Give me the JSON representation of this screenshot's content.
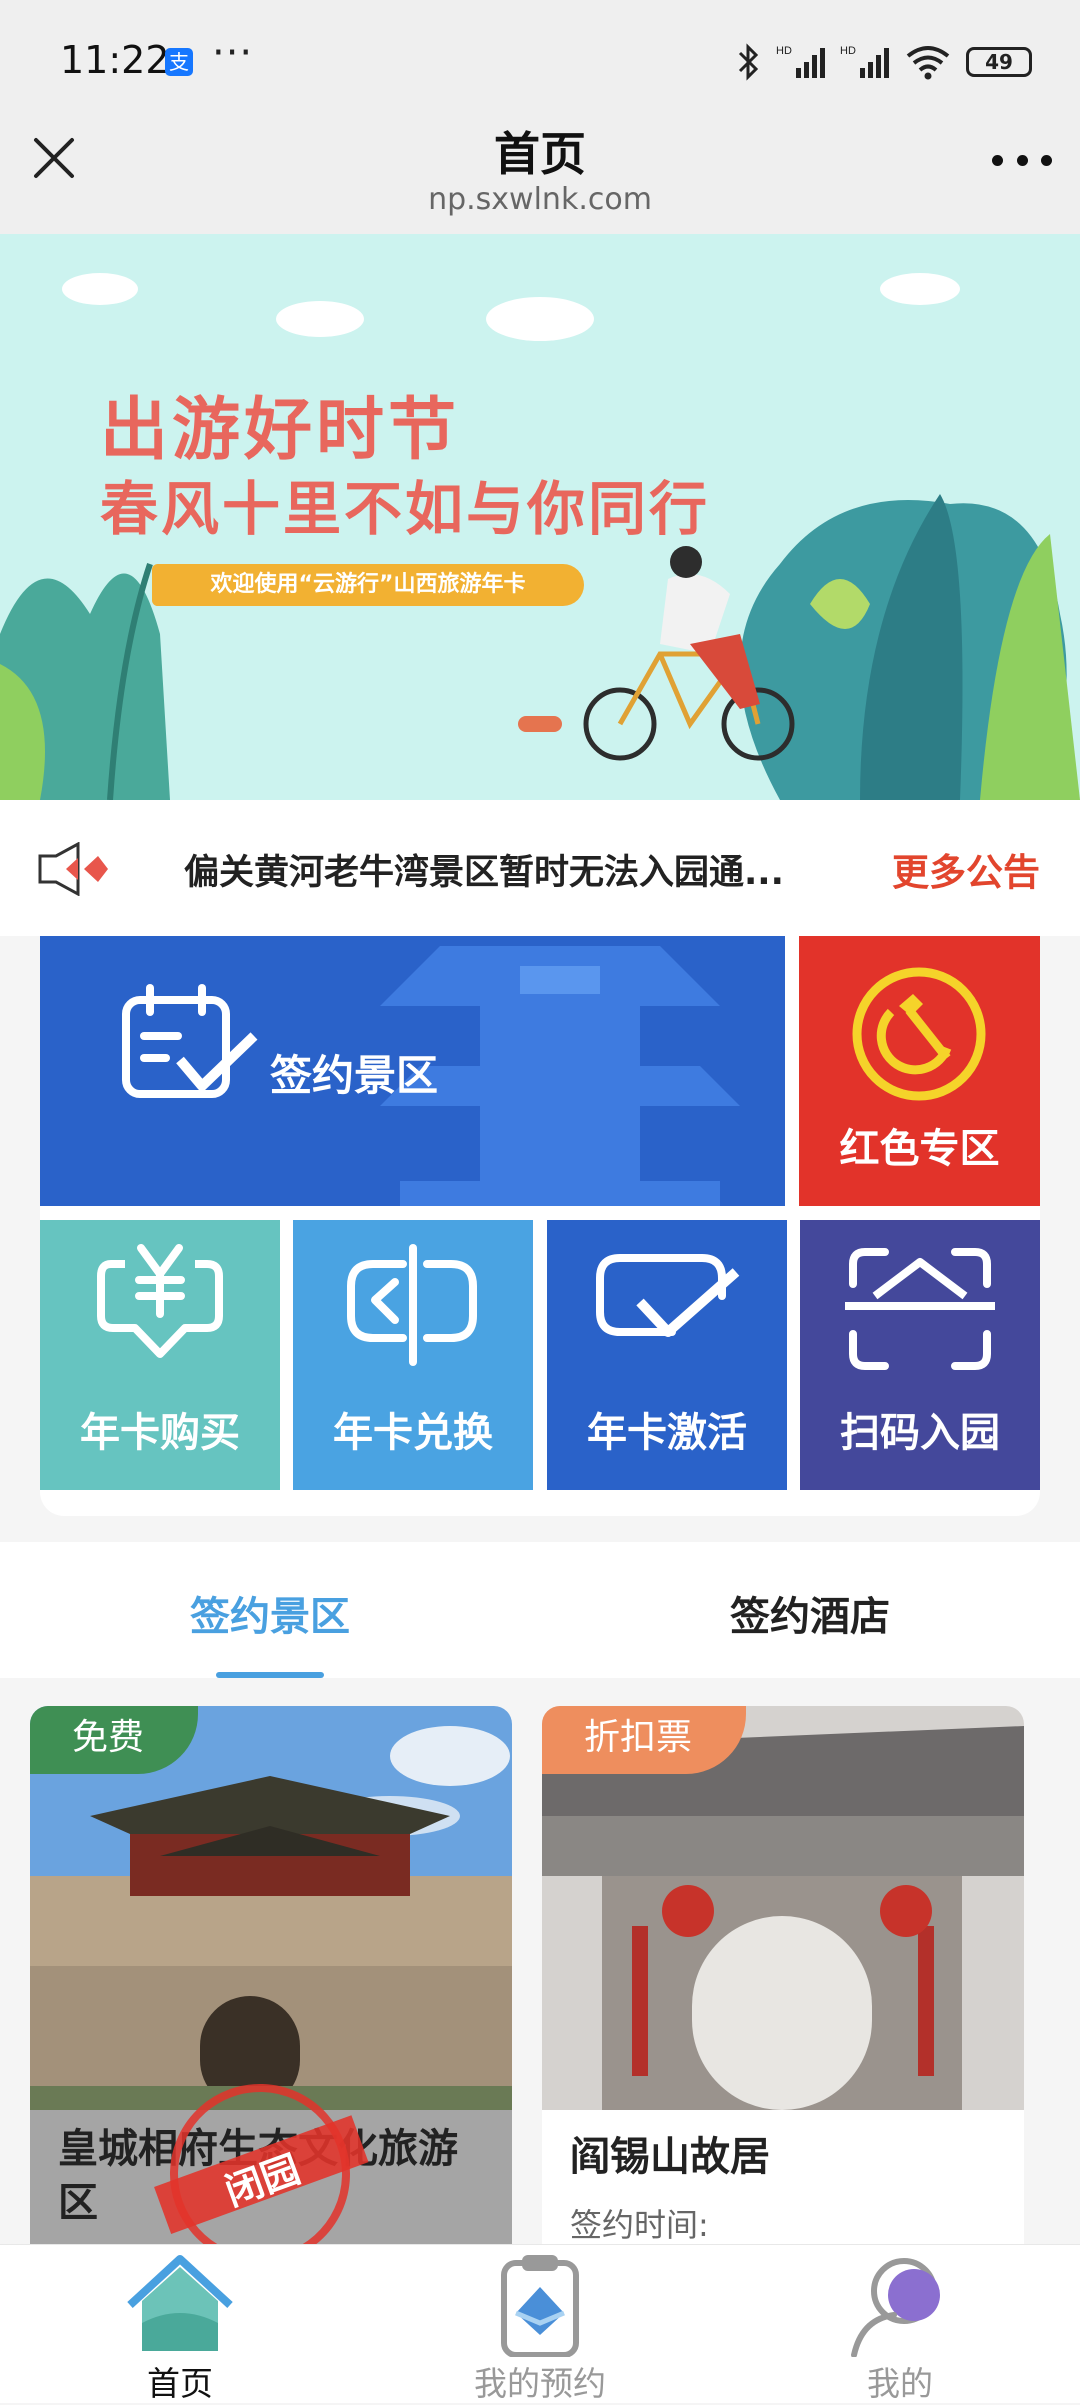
{
  "status": {
    "time": "11:22",
    "pay_glyph": "支",
    "dots": "···",
    "battery": "49"
  },
  "titlebar": {
    "title": "首页",
    "url": "np.sxwlnk.com"
  },
  "banner": {
    "line1": "出游好时节",
    "line2": "春风十里不如与你同行",
    "tag": "欢迎使用“云游行”山西旅游年卡"
  },
  "notice": {
    "text": "偏关黄河老牛湾景区暂时无法入园通...",
    "more": "更多公告"
  },
  "tiles": {
    "signed_scenic": "签约景区",
    "red_zone": "红色专区",
    "buy_card": "年卡购买",
    "exchange_card": "年卡兑换",
    "activate_card": "年卡激活",
    "scan_enter": "扫码入园"
  },
  "tabs": {
    "scenic": "签约景区",
    "hotel": "签约酒店"
  },
  "cards": [
    {
      "badge": "免费",
      "name": "皇城相府生态文化旅游区",
      "stamp": "闭园"
    },
    {
      "badge": "折扣票",
      "name": "阎锡山故居",
      "sub": "签约时间:"
    }
  ],
  "bottom_nav": {
    "home": "首页",
    "booking": "我的预约",
    "mine": "我的"
  },
  "colors": {
    "accent_blue": "#49a0e0",
    "notice_red": "#e2452d",
    "tile_blue": "#2a62c9",
    "tile_red": "#e2332a",
    "tile_teal": "#66c4c0",
    "tile_lightblue": "#4aa3e2",
    "tile_indigo": "#44489b"
  }
}
